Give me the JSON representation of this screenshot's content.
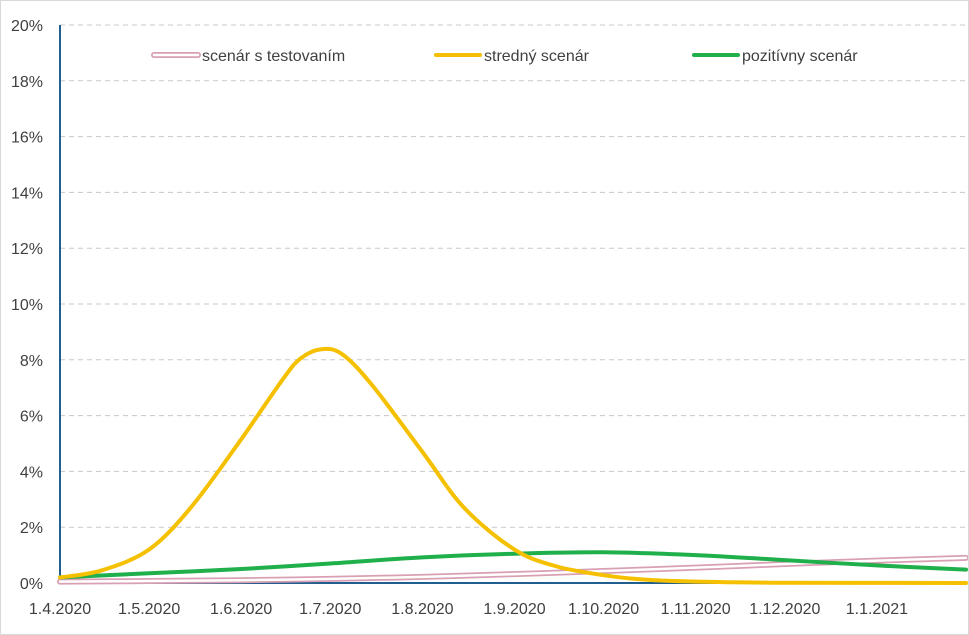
{
  "chart_data": {
    "type": "line",
    "title": "",
    "xlabel": "",
    "ylabel": "",
    "x_range": [
      "2020-04-01",
      "2021-01-31"
    ],
    "ylim": [
      0,
      20
    ],
    "y_ticks": [
      "0%",
      "2%",
      "4%",
      "6%",
      "8%",
      "10%",
      "12%",
      "14%",
      "16%",
      "18%",
      "20%"
    ],
    "x_ticks": [
      {
        "label": "1.4.2020",
        "date": "2020-04-01"
      },
      {
        "label": "1.5.2020",
        "date": "2020-05-01"
      },
      {
        "label": "1.6.2020",
        "date": "2020-06-01"
      },
      {
        "label": "1.7.2020",
        "date": "2020-07-01"
      },
      {
        "label": "1.8.2020",
        "date": "2020-08-01"
      },
      {
        "label": "1.9.2020",
        "date": "2020-09-01"
      },
      {
        "label": "1.10.2020",
        "date": "2020-10-01"
      },
      {
        "label": "1.11.2020",
        "date": "2020-11-01"
      },
      {
        "label": "1.12.2020",
        "date": "2020-12-01"
      },
      {
        "label": "1.1.2021",
        "date": "2021-01-01"
      }
    ],
    "grid": "horizontal dashed",
    "legend_position": "top",
    "series": [
      {
        "name": "scenár s testovaním",
        "color": "#d9a0b4",
        "style": "double-line",
        "points": [
          {
            "x": "2020-04-01",
            "y": 0.05
          },
          {
            "x": "2020-05-01",
            "y": 0.07
          },
          {
            "x": "2020-06-01",
            "y": 0.1
          },
          {
            "x": "2020-07-01",
            "y": 0.15
          },
          {
            "x": "2020-08-01",
            "y": 0.22
          },
          {
            "x": "2020-09-01",
            "y": 0.32
          },
          {
            "x": "2020-10-01",
            "y": 0.43
          },
          {
            "x": "2020-11-01",
            "y": 0.55
          },
          {
            "x": "2020-12-01",
            "y": 0.68
          },
          {
            "x": "2021-01-01",
            "y": 0.8
          },
          {
            "x": "2021-01-31",
            "y": 0.9
          }
        ]
      },
      {
        "name": "stredný scenár",
        "color": "#f5c000",
        "style": "solid",
        "points": [
          {
            "x": "2020-04-01",
            "y": 0.2
          },
          {
            "x": "2020-04-15",
            "y": 0.45
          },
          {
            "x": "2020-05-01",
            "y": 1.2
          },
          {
            "x": "2020-05-15",
            "y": 2.7
          },
          {
            "x": "2020-05-31",
            "y": 5.0
          },
          {
            "x": "2020-06-15",
            "y": 7.3
          },
          {
            "x": "2020-06-21",
            "y": 8.05
          },
          {
            "x": "2020-06-28",
            "y": 8.38
          },
          {
            "x": "2020-07-05",
            "y": 8.2
          },
          {
            "x": "2020-07-15",
            "y": 7.1
          },
          {
            "x": "2020-08-01",
            "y": 4.7
          },
          {
            "x": "2020-08-15",
            "y": 2.7
          },
          {
            "x": "2020-09-01",
            "y": 1.2
          },
          {
            "x": "2020-09-15",
            "y": 0.6
          },
          {
            "x": "2020-10-01",
            "y": 0.28
          },
          {
            "x": "2020-10-15",
            "y": 0.12
          },
          {
            "x": "2020-11-01",
            "y": 0.05
          },
          {
            "x": "2020-12-01",
            "y": 0.01
          },
          {
            "x": "2021-01-31",
            "y": 0.0
          }
        ]
      },
      {
        "name": "pozitívny scenár",
        "color": "#1faf4b",
        "style": "solid",
        "points": [
          {
            "x": "2020-04-01",
            "y": 0.2
          },
          {
            "x": "2020-05-01",
            "y": 0.35
          },
          {
            "x": "2020-06-01",
            "y": 0.5
          },
          {
            "x": "2020-07-01",
            "y": 0.7
          },
          {
            "x": "2020-08-01",
            "y": 0.92
          },
          {
            "x": "2020-09-01",
            "y": 1.05
          },
          {
            "x": "2020-10-01",
            "y": 1.1
          },
          {
            "x": "2020-11-01",
            "y": 1.0
          },
          {
            "x": "2020-12-01",
            "y": 0.82
          },
          {
            "x": "2021-01-01",
            "y": 0.63
          },
          {
            "x": "2021-01-31",
            "y": 0.48
          }
        ]
      }
    ]
  }
}
